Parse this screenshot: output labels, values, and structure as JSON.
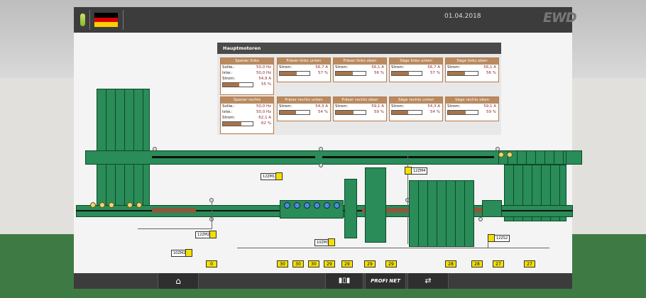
{
  "header": {
    "date": "01.04.2018",
    "logo_text": "EWD",
    "flag": "german-flag",
    "colors": {
      "frame": "#3c3c3c",
      "machine_green": "#2a8c58",
      "accent_brown": "#b98a5f"
    }
  },
  "panel": {
    "title": "Hauptmotoren",
    "cards": [
      {
        "title": "Spaner links",
        "rows": [
          {
            "label": "Sollw.:",
            "value": "50,0 Hz"
          },
          {
            "label": "Istw.:",
            "value": "50,0 Hz"
          },
          {
            "label": "Strom:",
            "value": "54,9 A"
          }
        ],
        "percent": "55 %",
        "level": 0.55
      },
      {
        "title": "Fräser links unten",
        "rows": [
          {
            "label": "Strom:",
            "value": "56,7 A"
          }
        ],
        "percent": "57 %",
        "level": 0.57
      },
      {
        "title": "Fräser links oben",
        "rows": [
          {
            "label": "Strom:",
            "value": "56,1 A"
          }
        ],
        "percent": "56 %",
        "level": 0.56
      },
      {
        "title": "Säge links unten",
        "rows": [
          {
            "label": "Strom:",
            "value": "56,7 A"
          }
        ],
        "percent": "57 %",
        "level": 0.57
      },
      {
        "title": "Säge links oben",
        "rows": [
          {
            "label": "Strom:",
            "value": "56,1 A"
          }
        ],
        "percent": "56 %",
        "level": 0.56
      },
      {
        "title": "Spaner rechts",
        "rows": [
          {
            "label": "Sollw.:",
            "value": "50,0 Hz"
          },
          {
            "label": "Istw.:",
            "value": "50,0 Hz"
          },
          {
            "label": "Strom:",
            "value": "62,1 A"
          }
        ],
        "percent": "62 %",
        "level": 0.62
      },
      {
        "title": "Fräser rechts unten",
        "rows": [
          {
            "label": "Strom:",
            "value": "54,3 A"
          }
        ],
        "percent": "54 %",
        "level": 0.54
      },
      {
        "title": "Fräser rechts oben",
        "rows": [
          {
            "label": "Strom:",
            "value": "59,1 A"
          }
        ],
        "percent": "59 %",
        "level": 0.59
      },
      {
        "title": "Säge rechts unten",
        "rows": [
          {
            "label": "Strom:",
            "value": "54,3 A"
          }
        ],
        "percent": "54 %",
        "level": 0.54
      },
      {
        "title": "Säge rechts oben",
        "rows": [
          {
            "label": "Strom:",
            "value": "59,1 A"
          }
        ],
        "percent": "59 %",
        "level": 0.59
      }
    ]
  },
  "tags": {
    "t1": "12ZM1",
    "t2": "12ZM4",
    "t3": "12ZM2",
    "t4": "10ZM3",
    "t5": "10ZM2",
    "t6": "12ZS2"
  },
  "numbers": [
    "0",
    "30",
    "30",
    "30",
    "29",
    "29",
    "29",
    "29",
    "28",
    "28",
    "27",
    "27"
  ],
  "footer": {
    "home_icon": "home-icon",
    "cabinet_icon": "cabinet-icon",
    "profinet_label": "PROFI NET",
    "network_icon": "network-icon"
  }
}
